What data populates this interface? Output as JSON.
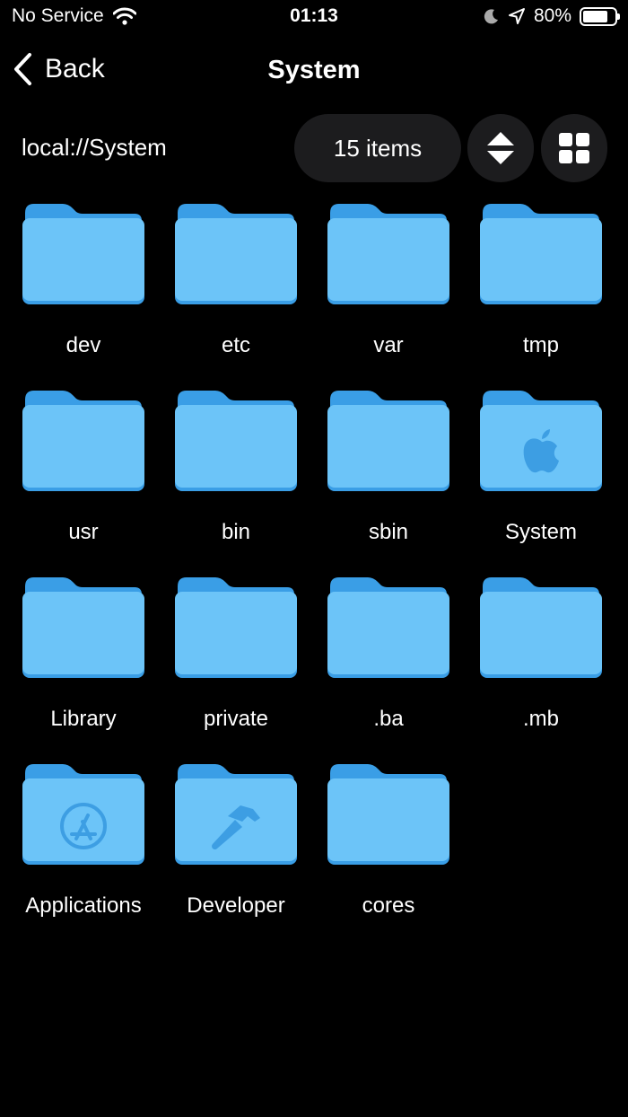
{
  "status": {
    "carrier": "No Service",
    "time": "01:13",
    "battery": "80%",
    "battery_level": 0.8
  },
  "nav": {
    "back_label": "Back",
    "title": "System"
  },
  "toolbar": {
    "path": "local://System",
    "count": "15 items",
    "sort_icon": "sort-updown-icon",
    "view_icon": "grid-view-icon"
  },
  "colors": {
    "folder_front": "#6cc4f8",
    "folder_back": "#3a9ee6",
    "glyph": "#3d9ee3",
    "pill_bg": "#1c1c1e"
  },
  "items": [
    {
      "label": "dev",
      "glyph": ""
    },
    {
      "label": "etc",
      "glyph": ""
    },
    {
      "label": "var",
      "glyph": ""
    },
    {
      "label": "tmp",
      "glyph": ""
    },
    {
      "label": "usr",
      "glyph": ""
    },
    {
      "label": "bin",
      "glyph": ""
    },
    {
      "label": "sbin",
      "glyph": ""
    },
    {
      "label": "System",
      "glyph": "apple"
    },
    {
      "label": "Library",
      "glyph": ""
    },
    {
      "label": "private",
      "glyph": ""
    },
    {
      "label": ".ba",
      "glyph": ""
    },
    {
      "label": ".mb",
      "glyph": ""
    },
    {
      "label": "Applications",
      "glyph": "appstore"
    },
    {
      "label": "Developer",
      "glyph": "hammer"
    },
    {
      "label": "cores",
      "glyph": ""
    }
  ]
}
